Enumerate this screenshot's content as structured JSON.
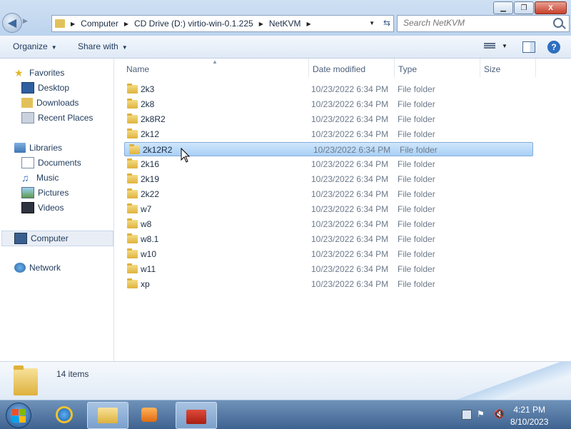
{
  "window": {
    "controls": {
      "minimize": "▁",
      "maximize": "❐",
      "close": "X"
    },
    "colors": {
      "accent": "#3d6aa0",
      "selection": "#cfe6fb",
      "folder": "#e3c15a"
    }
  },
  "address": {
    "crumbs": [
      "Computer",
      "CD Drive (D:) virtio-win-0.1.225",
      "NetKVM"
    ],
    "search_placeholder": "Search NetKVM"
  },
  "toolbar": {
    "organize": "Organize",
    "share_with": "Share with"
  },
  "nav": {
    "favorites": {
      "label": "Favorites",
      "items": [
        "Desktop",
        "Downloads",
        "Recent Places"
      ]
    },
    "libraries": {
      "label": "Libraries",
      "items": [
        "Documents",
        "Music",
        "Pictures",
        "Videos"
      ]
    },
    "computer": "Computer",
    "network": "Network"
  },
  "columns": {
    "name": "Name",
    "date": "Date modified",
    "type": "Type",
    "size": "Size"
  },
  "files": [
    {
      "name": "2k3",
      "date": "10/23/2022 6:34 PM",
      "type": "File folder"
    },
    {
      "name": "2k8",
      "date": "10/23/2022 6:34 PM",
      "type": "File folder"
    },
    {
      "name": "2k8R2",
      "date": "10/23/2022 6:34 PM",
      "type": "File folder"
    },
    {
      "name": "2k12",
      "date": "10/23/2022 6:34 PM",
      "type": "File folder"
    },
    {
      "name": "2k12R2",
      "date": "10/23/2022 6:34 PM",
      "type": "File folder",
      "selected": true
    },
    {
      "name": "2k16",
      "date": "10/23/2022 6:34 PM",
      "type": "File folder"
    },
    {
      "name": "2k19",
      "date": "10/23/2022 6:34 PM",
      "type": "File folder"
    },
    {
      "name": "2k22",
      "date": "10/23/2022 6:34 PM",
      "type": "File folder"
    },
    {
      "name": "w7",
      "date": "10/23/2022 6:34 PM",
      "type": "File folder"
    },
    {
      "name": "w8",
      "date": "10/23/2022 6:34 PM",
      "type": "File folder"
    },
    {
      "name": "w8.1",
      "date": "10/23/2022 6:34 PM",
      "type": "File folder"
    },
    {
      "name": "w10",
      "date": "10/23/2022 6:34 PM",
      "type": "File folder"
    },
    {
      "name": "w11",
      "date": "10/23/2022 6:34 PM",
      "type": "File folder"
    },
    {
      "name": "xp",
      "date": "10/23/2022 6:34 PM",
      "type": "File folder"
    }
  ],
  "details": {
    "count": "14 items"
  },
  "taskbar": {
    "time": "4:21 PM",
    "date": "8/10/2023",
    "icons": [
      "start-orb-icon",
      "internet-explorer-icon",
      "windows-explorer-icon",
      "media-player-icon",
      "toolbox-icon"
    ]
  }
}
